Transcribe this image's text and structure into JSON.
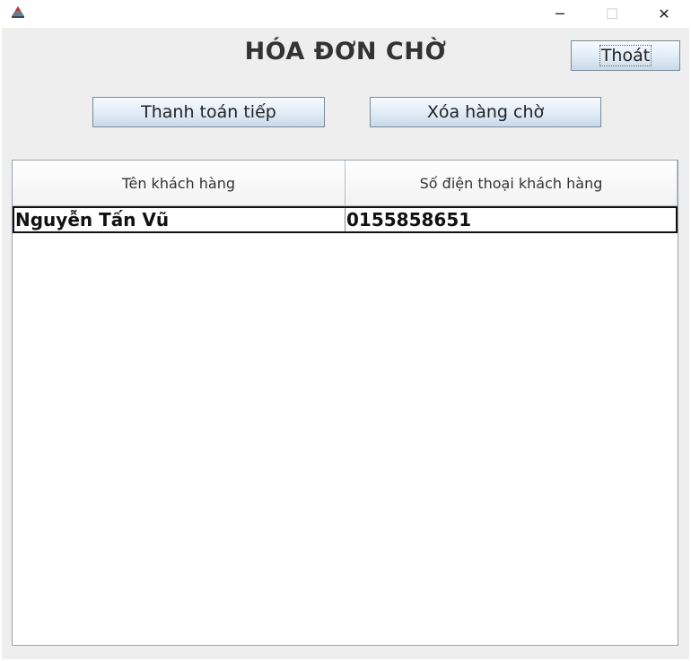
{
  "window": {
    "minimize_glyph": "─",
    "maximize_glyph": "☐",
    "close_glyph": "✕"
  },
  "header": {
    "title": "HÓA ĐƠN CHỜ",
    "exit_label": "Thoát"
  },
  "actions": {
    "continue_payment_label": "Thanh toán tiếp",
    "delete_waiting_label": "Xóa hàng chờ"
  },
  "table": {
    "columns": [
      "Tên khách hàng",
      "Số điện thoại khách hàng"
    ],
    "rows": [
      {
        "name": "Nguyễn Tấn Vũ",
        "phone": "0155858651"
      }
    ]
  }
}
